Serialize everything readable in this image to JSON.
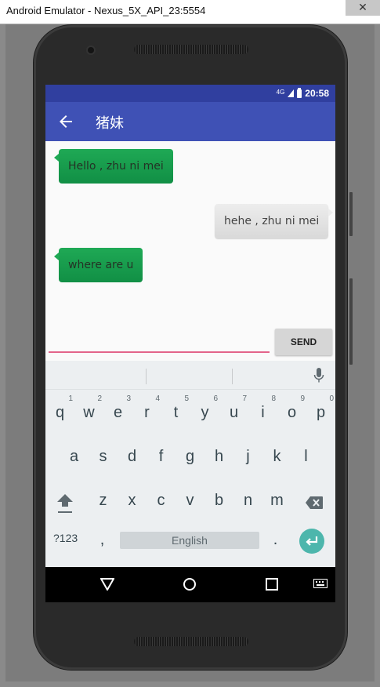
{
  "window": {
    "title": "Android Emulator - Nexus_5X_API_23:5554",
    "close_label": "✕"
  },
  "status_bar": {
    "network": "4G",
    "time": "20:58"
  },
  "app_bar": {
    "title": "猪妹"
  },
  "messages": [
    {
      "text": "Hello , zhu ni mei",
      "side": "received"
    },
    {
      "text": "hehe , zhu ni mei",
      "side": "sent"
    },
    {
      "text": "where are u",
      "side": "received"
    }
  ],
  "composer": {
    "input_value": "",
    "send_label": "SEND"
  },
  "keyboard": {
    "row1": [
      "q",
      "w",
      "e",
      "r",
      "t",
      "y",
      "u",
      "i",
      "o",
      "p"
    ],
    "row1_hints": [
      "1",
      "2",
      "3",
      "4",
      "5",
      "6",
      "7",
      "8",
      "9",
      "0"
    ],
    "row2": [
      "a",
      "s",
      "d",
      "f",
      "g",
      "h",
      "j",
      "k",
      "l"
    ],
    "row3": [
      "z",
      "x",
      "c",
      "v",
      "b",
      "n",
      "m"
    ],
    "symbols_label": "?123",
    "comma": ",",
    "space_label": "English",
    "period": "."
  },
  "colors": {
    "status_bar": "#303f9f",
    "app_bar": "#3f51b5",
    "received_bubble": "#1fa955",
    "sent_bubble": "#e6e6e6",
    "input_underline": "#e3648a",
    "enter_key": "#4db6ac"
  },
  "icons": [
    "back-arrow-icon",
    "signal-icon",
    "battery-icon",
    "mic-icon",
    "shift-icon",
    "backspace-icon",
    "enter-icon",
    "nav-back-icon",
    "nav-home-icon",
    "nav-recents-icon",
    "keyboard-icon"
  ]
}
